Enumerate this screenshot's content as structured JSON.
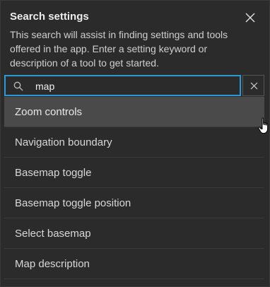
{
  "dialog": {
    "title": "Search settings",
    "description": "This search will assist in finding settings and tools offered in the app. Enter a setting keyword or description of a tool to get started.",
    "close_icon": "close-icon"
  },
  "search": {
    "value": "map",
    "icon": "search-icon",
    "clear_icon": "clear-icon",
    "accent_color": "#2a9bd4"
  },
  "results": [
    {
      "label": "Zoom controls"
    },
    {
      "label": "Navigation boundary"
    },
    {
      "label": "Basemap toggle"
    },
    {
      "label": "Basemap toggle position"
    },
    {
      "label": "Select basemap"
    },
    {
      "label": "Map description"
    }
  ]
}
